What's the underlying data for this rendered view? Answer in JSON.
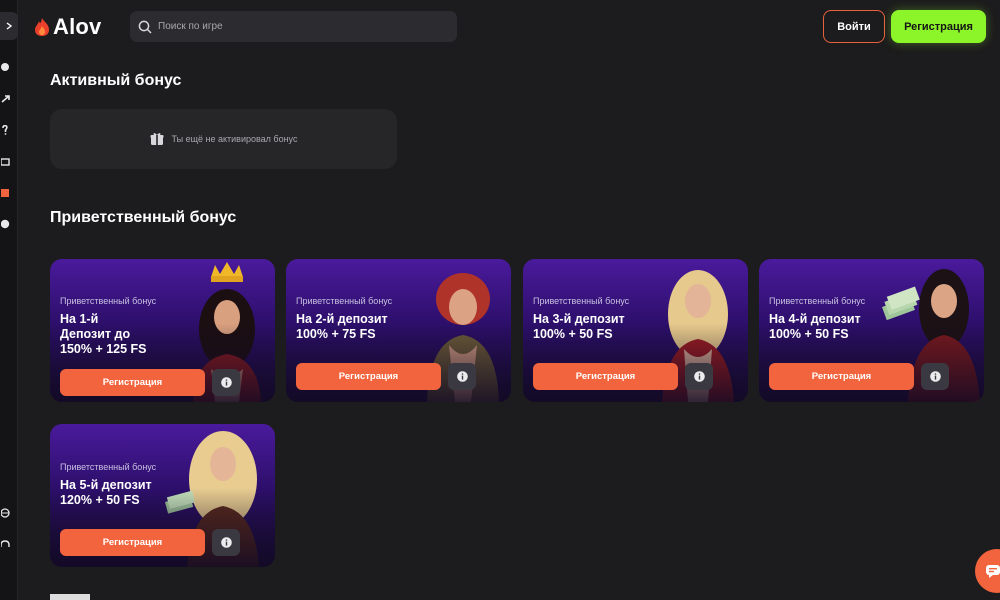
{
  "header": {
    "logo_text": "Alov",
    "search_placeholder": "Поиск по игре",
    "login_label": "Войти",
    "register_label": "Регистрация"
  },
  "active_bonus": {
    "title": "Активный бонус",
    "empty_text": "Ты ещё не активировал бонус"
  },
  "welcome": {
    "title": "Приветственный бонус",
    "cards": [
      {
        "subtitle": "Приветственный бонус",
        "line1": "На 1-й",
        "line2": "Депозит до",
        "line3": "150% + 125 FS",
        "button": "Регистрация"
      },
      {
        "subtitle": "Приветственный бонус",
        "line1": "На 2-й депозит",
        "line2": "100% + 75 FS",
        "button": "Регистрация"
      },
      {
        "subtitle": "Приветственный бонус",
        "line1": "На 3-й депозит",
        "line2": "100% + 50 FS",
        "button": "Регистрация"
      },
      {
        "subtitle": "Приветственный бонус",
        "line1": "На 4-й депозит",
        "line2": "100% + 50 FS",
        "button": "Регистрация"
      },
      {
        "subtitle": "Приветственный бонус",
        "line1": "На 5-й депозит",
        "line2": "120% + 50 FS",
        "button": "Регистрация"
      }
    ]
  },
  "colors": {
    "background": "#1c1b1d",
    "accent_orange": "#f2643e",
    "accent_green": "#8cf52a",
    "card_purple": "#4a1a9c"
  },
  "icons": {
    "sidebar_toggle": "chevron-right-icon",
    "search": "search-icon",
    "gift": "gift-icon",
    "info": "info-icon",
    "chat": "chat-icon"
  }
}
